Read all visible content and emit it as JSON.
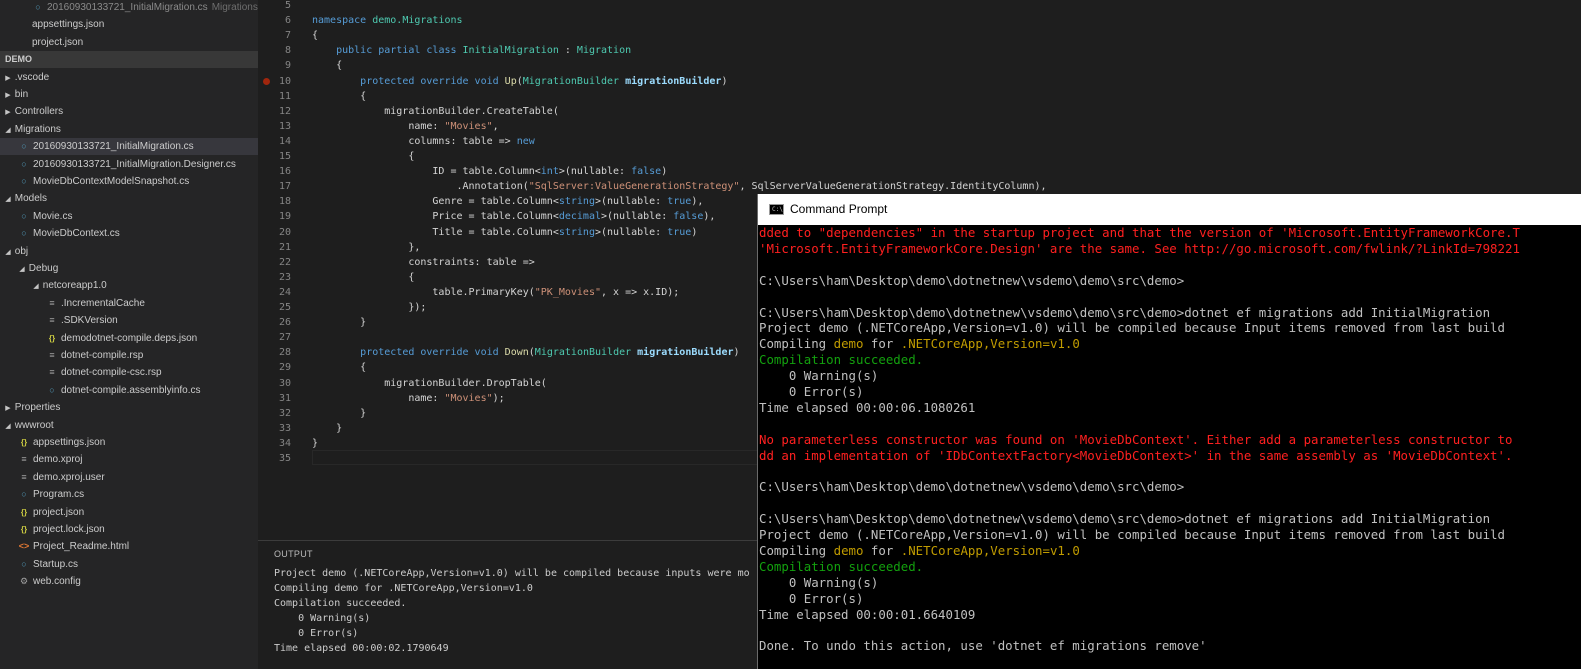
{
  "sidebar": {
    "rows": [
      {
        "label": "20160930133721_InitialMigration.cs",
        "desc": "Migrations",
        "indent": 2,
        "kind": "file",
        "icon": "csharp-file-icon",
        "faded": true
      },
      {
        "label": "appsettings.json",
        "indent": 2,
        "kind": "file",
        "icon": "none"
      },
      {
        "label": "project.json",
        "indent": 2,
        "kind": "file",
        "icon": "none"
      },
      {
        "label": "DEMO",
        "indent": 0,
        "kind": "section"
      },
      {
        "label": ".vscode",
        "indent": 0,
        "kind": "folder",
        "expanded": false
      },
      {
        "label": "bin",
        "indent": 0,
        "kind": "folder",
        "expanded": false
      },
      {
        "label": "Controllers",
        "indent": 0,
        "kind": "folder",
        "expanded": false
      },
      {
        "label": "Migrations",
        "indent": 0,
        "kind": "folder",
        "expanded": true
      },
      {
        "label": "20160930133721_InitialMigration.cs",
        "indent": 1,
        "kind": "file",
        "icon": "csharp-file-icon",
        "selected": true
      },
      {
        "label": "20160930133721_InitialMigration.Designer.cs",
        "indent": 1,
        "kind": "file",
        "icon": "csharp-file-icon"
      },
      {
        "label": "MovieDbContextModelSnapshot.cs",
        "indent": 1,
        "kind": "file",
        "icon": "csharp-file-icon"
      },
      {
        "label": "Models",
        "indent": 0,
        "kind": "folder",
        "expanded": true
      },
      {
        "label": "Movie.cs",
        "indent": 1,
        "kind": "file",
        "icon": "csharp-file-icon"
      },
      {
        "label": "MovieDbContext.cs",
        "indent": 1,
        "kind": "file",
        "icon": "csharp-file-icon"
      },
      {
        "label": "obj",
        "indent": 0,
        "kind": "folder",
        "expanded": true
      },
      {
        "label": "Debug",
        "indent": 1,
        "kind": "folder",
        "expanded": true
      },
      {
        "label": "netcoreapp1.0",
        "indent": 2,
        "kind": "folder",
        "expanded": true
      },
      {
        "label": ".IncrementalCache",
        "indent": 3,
        "kind": "file",
        "icon": "text-file-icon"
      },
      {
        "label": ".SDKVersion",
        "indent": 3,
        "kind": "file",
        "icon": "text-file-icon"
      },
      {
        "label": "demodotnet-compile.deps.json",
        "indent": 3,
        "kind": "file",
        "icon": "json-file-icon"
      },
      {
        "label": "dotnet-compile.rsp",
        "indent": 3,
        "kind": "file",
        "icon": "text-file-icon"
      },
      {
        "label": "dotnet-compile-csc.rsp",
        "indent": 3,
        "kind": "file",
        "icon": "text-file-icon"
      },
      {
        "label": "dotnet-compile.assemblyinfo.cs",
        "indent": 3,
        "kind": "file",
        "icon": "csharp-file-icon"
      },
      {
        "label": "Properties",
        "indent": 0,
        "kind": "folder",
        "expanded": false
      },
      {
        "label": "wwwroot",
        "indent": 0,
        "kind": "folder",
        "expanded": true
      },
      {
        "label": "appsettings.json",
        "indent": 1,
        "kind": "file",
        "icon": "json-file-icon"
      },
      {
        "label": "demo.xproj",
        "indent": 1,
        "kind": "file",
        "icon": "text-file-icon"
      },
      {
        "label": "demo.xproj.user",
        "indent": 1,
        "kind": "file",
        "icon": "text-file-icon"
      },
      {
        "label": "Program.cs",
        "indent": 1,
        "kind": "file",
        "icon": "csharp-file-icon"
      },
      {
        "label": "project.json",
        "indent": 1,
        "kind": "file",
        "icon": "json-file-icon"
      },
      {
        "label": "project.lock.json",
        "indent": 1,
        "kind": "file",
        "icon": "json-file-icon"
      },
      {
        "label": "Project_Readme.html",
        "indent": 1,
        "kind": "file",
        "icon": "html-file-icon"
      },
      {
        "label": "Startup.cs",
        "indent": 1,
        "kind": "file",
        "icon": "csharp-file-icon"
      },
      {
        "label": "web.config",
        "indent": 1,
        "kind": "file",
        "icon": "gear-icon"
      }
    ]
  },
  "editor": {
    "breakpoint_line": 10,
    "lines": [
      {
        "n": "5",
        "tokens": []
      },
      {
        "n": "6",
        "tokens": [
          [
            "kw",
            "namespace "
          ],
          [
            "ty",
            "demo.Migrations"
          ]
        ]
      },
      {
        "n": "7",
        "tokens": [
          [
            "",
            "{"
          ]
        ]
      },
      {
        "n": "8",
        "tokens": [
          [
            "",
            "    "
          ],
          [
            "kw",
            "public partial class "
          ],
          [
            "ty",
            "InitialMigration"
          ],
          [
            "",
            " : "
          ],
          [
            "ty",
            "Migration"
          ]
        ]
      },
      {
        "n": "9",
        "tokens": [
          [
            "",
            "    {"
          ]
        ]
      },
      {
        "n": "10",
        "tokens": [
          [
            "",
            "        "
          ],
          [
            "kw",
            "protected override void "
          ],
          [
            "fn",
            "Up"
          ],
          [
            "",
            "("
          ],
          [
            "ty",
            "MigrationBuilder "
          ],
          [
            "pa",
            "migrationBuilder"
          ],
          [
            "",
            ")"
          ]
        ]
      },
      {
        "n": "11",
        "tokens": [
          [
            "",
            "        {"
          ]
        ]
      },
      {
        "n": "12",
        "tokens": [
          [
            "",
            "            migrationBuilder.CreateTable("
          ]
        ]
      },
      {
        "n": "13",
        "tokens": [
          [
            "",
            "                name: "
          ],
          [
            "st",
            "\"Movies\""
          ],
          [
            "",
            ","
          ]
        ]
      },
      {
        "n": "14",
        "tokens": [
          [
            "",
            "                columns: table => "
          ],
          [
            "kw",
            "new"
          ]
        ]
      },
      {
        "n": "15",
        "tokens": [
          [
            "",
            "                {"
          ]
        ]
      },
      {
        "n": "16",
        "tokens": [
          [
            "",
            "                    ID = table.Column<"
          ],
          [
            "kw",
            "int"
          ],
          [
            "",
            ">(nullable: "
          ],
          [
            "kw",
            "false"
          ],
          [
            "",
            ")"
          ]
        ]
      },
      {
        "n": "17",
        "tokens": [
          [
            "",
            "                        .Annotation("
          ],
          [
            "st",
            "\"SqlServer:ValueGenerationStrategy\""
          ],
          [
            "",
            ", SqlServerValueGenerationStrategy.IdentityColumn),"
          ]
        ]
      },
      {
        "n": "18",
        "tokens": [
          [
            "",
            "                    Genre = table.Column<"
          ],
          [
            "kw",
            "string"
          ],
          [
            "",
            ">(nullable: "
          ],
          [
            "kw",
            "true"
          ],
          [
            "",
            "),"
          ]
        ]
      },
      {
        "n": "19",
        "tokens": [
          [
            "",
            "                    Price = table.Column<"
          ],
          [
            "kw",
            "decimal"
          ],
          [
            "",
            ">(nullable: "
          ],
          [
            "kw",
            "false"
          ],
          [
            "",
            "),"
          ]
        ]
      },
      {
        "n": "20",
        "tokens": [
          [
            "",
            "                    Title = table.Column<"
          ],
          [
            "kw",
            "string"
          ],
          [
            "",
            ">(nullable: "
          ],
          [
            "kw",
            "true"
          ],
          [
            "",
            ")"
          ]
        ]
      },
      {
        "n": "21",
        "tokens": [
          [
            "",
            "                },"
          ]
        ]
      },
      {
        "n": "22",
        "tokens": [
          [
            "",
            "                constraints: table =>"
          ]
        ]
      },
      {
        "n": "23",
        "tokens": [
          [
            "",
            "                {"
          ]
        ]
      },
      {
        "n": "24",
        "tokens": [
          [
            "",
            "                    table.PrimaryKey("
          ],
          [
            "st",
            "\"PK_Movies\""
          ],
          [
            "",
            ", x => x.ID);"
          ]
        ]
      },
      {
        "n": "25",
        "tokens": [
          [
            "",
            "                });"
          ]
        ]
      },
      {
        "n": "26",
        "tokens": [
          [
            "",
            "        }"
          ]
        ]
      },
      {
        "n": "27",
        "tokens": []
      },
      {
        "n": "28",
        "tokens": [
          [
            "",
            "        "
          ],
          [
            "kw",
            "protected override void "
          ],
          [
            "fn",
            "Down"
          ],
          [
            "",
            "("
          ],
          [
            "ty",
            "MigrationBuilder "
          ],
          [
            "pa",
            "migrationBuilder"
          ],
          [
            "",
            ")"
          ]
        ]
      },
      {
        "n": "29",
        "tokens": [
          [
            "",
            "        {"
          ]
        ]
      },
      {
        "n": "30",
        "tokens": [
          [
            "",
            "            migrationBuilder.DropTable("
          ]
        ]
      },
      {
        "n": "31",
        "tokens": [
          [
            "",
            "                name: "
          ],
          [
            "st",
            "\"Movies\""
          ],
          [
            "",
            ");"
          ]
        ]
      },
      {
        "n": "32",
        "tokens": [
          [
            "",
            "        }"
          ]
        ]
      },
      {
        "n": "33",
        "tokens": [
          [
            "",
            "    }"
          ]
        ]
      },
      {
        "n": "34",
        "tokens": [
          [
            "",
            "}"
          ]
        ]
      },
      {
        "n": "35",
        "tokens": []
      }
    ]
  },
  "output": {
    "title": "OUTPUT",
    "lines": [
      "Project demo (.NETCoreApp,Version=v1.0) will be compiled because inputs were mo",
      "Compiling demo for .NETCoreApp,Version=v1.0",
      "Compilation succeeded.",
      "    0 Warning(s)",
      "    0 Error(s)",
      "Time elapsed 00:00:02.1790649"
    ]
  },
  "cmd": {
    "title": "Command Prompt",
    "icon_text": "C:\\",
    "lines": [
      [
        [
          "red",
          "dded to \"dependencies\" in the startup project and that the version of 'Microsoft.EntityFrameworkCore.T"
        ]
      ],
      [
        [
          "red",
          "'Microsoft.EntityFrameworkCore.Design' are the same. See http://go.microsoft.com/fwlink/?LinkId=798221"
        ]
      ],
      [],
      [
        [
          "",
          "C:\\Users\\ham\\Desktop\\demo\\dotnetnew\\vsdemo\\demo\\src\\demo>"
        ]
      ],
      [],
      [
        [
          "",
          "C:\\Users\\ham\\Desktop\\demo\\dotnetnew\\vsdemo\\demo\\src\\demo>dotnet ef migrations add InitialMigration"
        ]
      ],
      [
        [
          "",
          "Project demo (.NETCoreApp,Version=v1.0) will be compiled because Input items removed from last build"
        ]
      ],
      [
        [
          "",
          "Compiling "
        ],
        [
          "yellow",
          "demo"
        ],
        [
          "",
          " for "
        ],
        [
          "yellow",
          ".NETCoreApp,Version=v1.0"
        ]
      ],
      [
        [
          "green",
          "Compilation succeeded."
        ]
      ],
      [
        [
          "",
          "    0 Warning(s)"
        ]
      ],
      [
        [
          "",
          "    0 Error(s)"
        ]
      ],
      [
        [
          "",
          "Time elapsed 00:00:06.1080261"
        ]
      ],
      [],
      [
        [
          "red",
          "No parameterless constructor was found on 'MovieDbContext'. Either add a parameterless constructor to"
        ]
      ],
      [
        [
          "red",
          "dd an implementation of 'IDbContextFactory<MovieDbContext>' in the same assembly as 'MovieDbContext'."
        ]
      ],
      [],
      [
        [
          "",
          "C:\\Users\\ham\\Desktop\\demo\\dotnetnew\\vsdemo\\demo\\src\\demo>"
        ]
      ],
      [],
      [
        [
          "",
          "C:\\Users\\ham\\Desktop\\demo\\dotnetnew\\vsdemo\\demo\\src\\demo>dotnet ef migrations add InitialMigration"
        ]
      ],
      [
        [
          "",
          "Project demo (.NETCoreApp,Version=v1.0) will be compiled because Input items removed from last build"
        ]
      ],
      [
        [
          "",
          "Compiling "
        ],
        [
          "yellow",
          "demo"
        ],
        [
          "",
          " for "
        ],
        [
          "yellow",
          ".NETCoreApp,Version=v1.0"
        ]
      ],
      [
        [
          "green",
          "Compilation succeeded."
        ]
      ],
      [
        [
          "",
          "    0 Warning(s)"
        ]
      ],
      [
        [
          "",
          "    0 Error(s)"
        ]
      ],
      [
        [
          "",
          "Time elapsed 00:00:01.6640109"
        ]
      ],
      [],
      [
        [
          "",
          "Done. To undo this action, use 'dotnet ef migrations remove'"
        ]
      ]
    ]
  },
  "colors": {
    "sidebar_bg": "#252526",
    "editor_bg": "#1e1e1e",
    "cmd_bg": "#000000",
    "cmd_error": "#ff2020",
    "cmd_success": "#13a10e",
    "keyword": "#569cd6",
    "type": "#4ec9b0",
    "string": "#ce9178"
  }
}
